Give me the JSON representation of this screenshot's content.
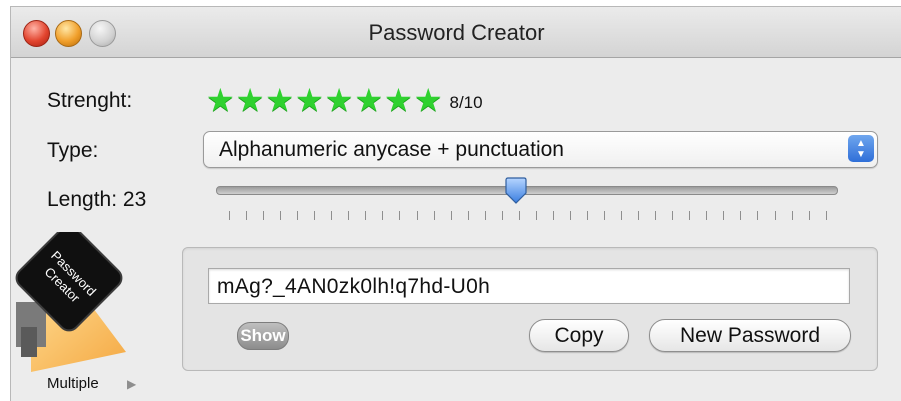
{
  "window": {
    "title": "Password Creator"
  },
  "strength": {
    "label": "Strenght:",
    "filled_stars": 8,
    "max_stars": 10,
    "count_text": "8/10",
    "star_color": "#2fd12f"
  },
  "type": {
    "label": "Type:",
    "selected": "Alphanumeric anycase + punctuation"
  },
  "length": {
    "label": "Length: 23",
    "value": 23,
    "slider_fraction": 0.5
  },
  "password": {
    "value": "mAg?_4AN0zk0lh!q7hd-U0h"
  },
  "buttons": {
    "show": "Show",
    "copy": "Copy",
    "new_password": "New Password"
  },
  "icon": {
    "name": "password-creator-app-icon",
    "lettering": "PasswordCreator"
  },
  "multiple": {
    "label": "Multiple",
    "icon": "disclosure-triangle-icon"
  }
}
